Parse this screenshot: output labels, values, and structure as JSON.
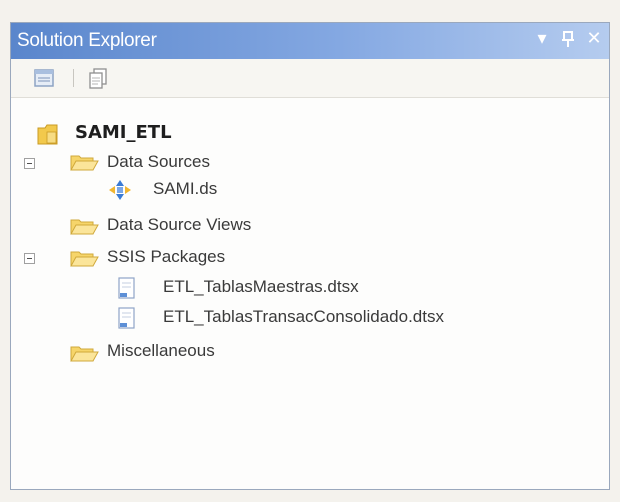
{
  "window": {
    "title": "Solution Explorer",
    "buttons": {
      "dropdown": "▾",
      "pin": "ᚐ",
      "close": "✕"
    }
  },
  "toolbar": {
    "icons": [
      "properties-icon",
      "show-all-files-icon"
    ]
  },
  "tree": {
    "root": "SAMI_ETL",
    "data_sources": "Data Sources",
    "data_source_item": "SAMI.ds",
    "data_source_views": "Data Source Views",
    "ssis_packages": "SSIS Packages",
    "package_1": "ETL_TablasMaestras.dtsx",
    "package_2": "ETL_TablasTransacConsolidado.dtsx",
    "miscellaneous": "Miscellaneous"
  },
  "colors": {
    "title_gradient_start": "#5a86cc",
    "title_gradient_end": "#b5ccef",
    "folder": "#f6d56a"
  }
}
